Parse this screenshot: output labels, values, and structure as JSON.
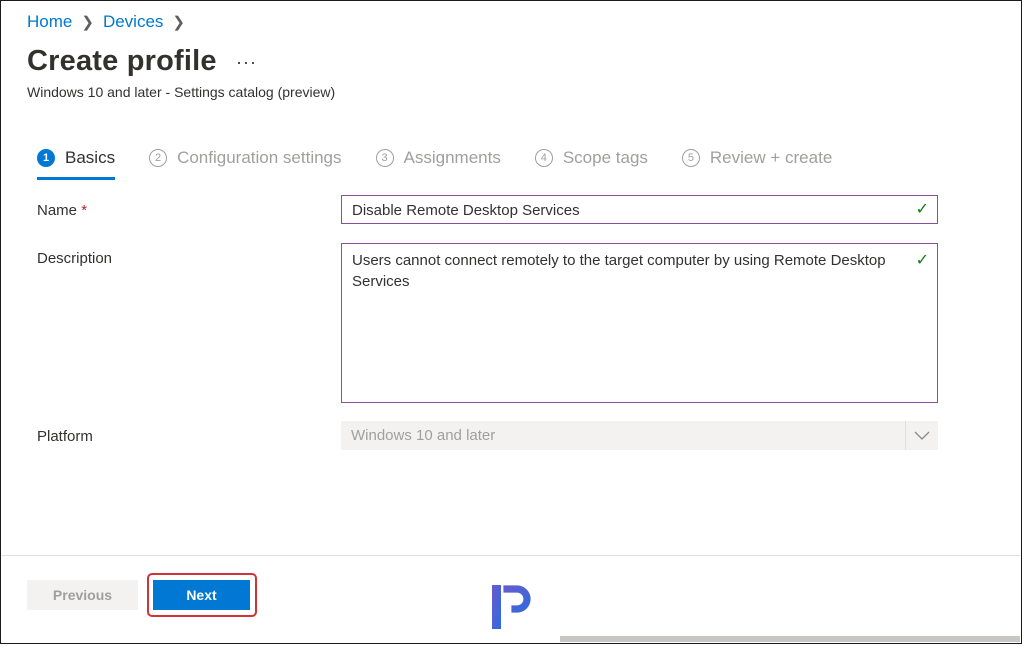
{
  "breadcrumb": {
    "home": "Home",
    "devices": "Devices"
  },
  "header": {
    "title": "Create profile",
    "more": "···",
    "subtitle": "Windows 10 and later - Settings catalog (preview)"
  },
  "steps": [
    {
      "num": "1",
      "label": "Basics",
      "active": true
    },
    {
      "num": "2",
      "label": "Configuration settings"
    },
    {
      "num": "3",
      "label": "Assignments"
    },
    {
      "num": "4",
      "label": "Scope tags"
    },
    {
      "num": "5",
      "label": "Review + create"
    }
  ],
  "form": {
    "name_label": "Name",
    "required_mark": "*",
    "name_value": "Disable Remote Desktop Services",
    "description_label": "Description",
    "description_value": "Users cannot connect remotely to the target computer by using Remote Desktop Services",
    "platform_label": "Platform",
    "platform_value": "Windows 10 and later"
  },
  "footer": {
    "previous": "Previous",
    "next": "Next"
  },
  "colors": {
    "accent": "#0078d4",
    "highlight": "#d13438",
    "valid": "#107c10"
  }
}
